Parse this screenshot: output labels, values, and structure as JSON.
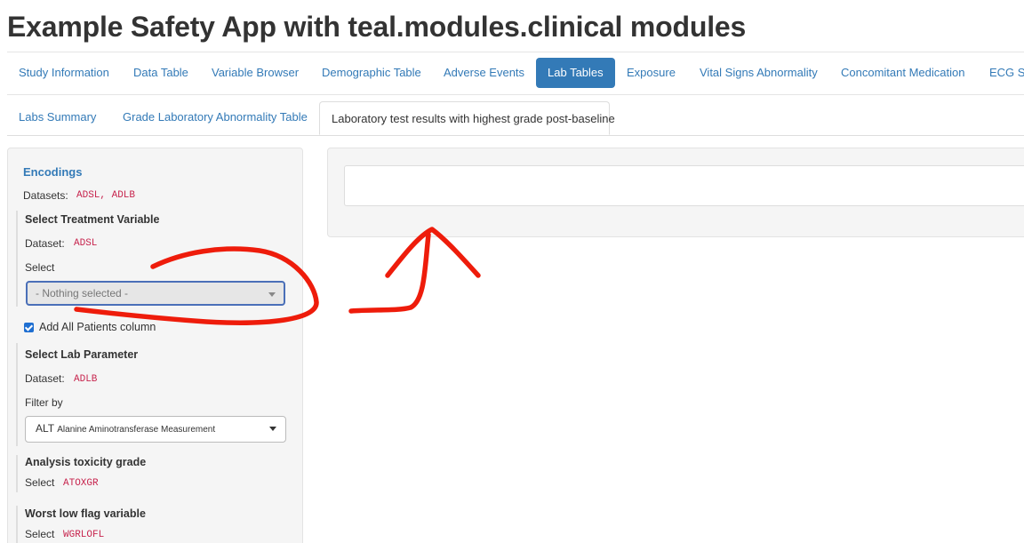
{
  "app": {
    "title": "Example Safety App with teal.modules.clinical modules"
  },
  "main_tabs": [
    {
      "label": "Study Information",
      "active": false
    },
    {
      "label": "Data Table",
      "active": false
    },
    {
      "label": "Variable Browser",
      "active": false
    },
    {
      "label": "Demographic Table",
      "active": false
    },
    {
      "label": "Adverse Events",
      "active": false
    },
    {
      "label": "Lab Tables",
      "active": true
    },
    {
      "label": "Exposure",
      "active": false
    },
    {
      "label": "Vital Signs Abnormality",
      "active": false
    },
    {
      "label": "Concomitant Medication",
      "active": false
    },
    {
      "label": "ECG S",
      "active": false
    }
  ],
  "sub_tabs": [
    {
      "label": "Labs Summary",
      "active": false
    },
    {
      "label": "Grade Laboratory Abnormality Table",
      "active": false
    },
    {
      "label": "Laboratory test results with highest grade post-baseline",
      "active": true
    }
  ],
  "encodings": {
    "title": "Encodings",
    "datasets_label": "Datasets:",
    "datasets_value": "ADSL, ADLB",
    "treatment": {
      "title": "Select Treatment Variable",
      "dataset_label": "Dataset:",
      "dataset_value": "ADSL",
      "select_label": "Select",
      "placeholder": "- Nothing selected -"
    },
    "all_patients": {
      "label": "Add All Patients column",
      "checked": true
    },
    "lab_param": {
      "title": "Select Lab Parameter",
      "dataset_label": "Dataset:",
      "dataset_value": "ADLB",
      "filter_label": "Filter by",
      "selected_code": "ALT",
      "selected_desc": "Alanine Aminotransferase Measurement"
    },
    "toxicity": {
      "title": "Analysis toxicity grade",
      "select_label": "Select",
      "select_value": "ATOXGR"
    },
    "worst_low": {
      "title": "Worst low flag variable",
      "select_label": "Select",
      "select_value": "WGRLOFL"
    }
  },
  "colors": {
    "link": "#337ab7",
    "active_tab_bg": "#337ab7",
    "code": "#c7254e",
    "annotation": "#ee1c0b",
    "panel_bg": "#f5f5f5"
  }
}
